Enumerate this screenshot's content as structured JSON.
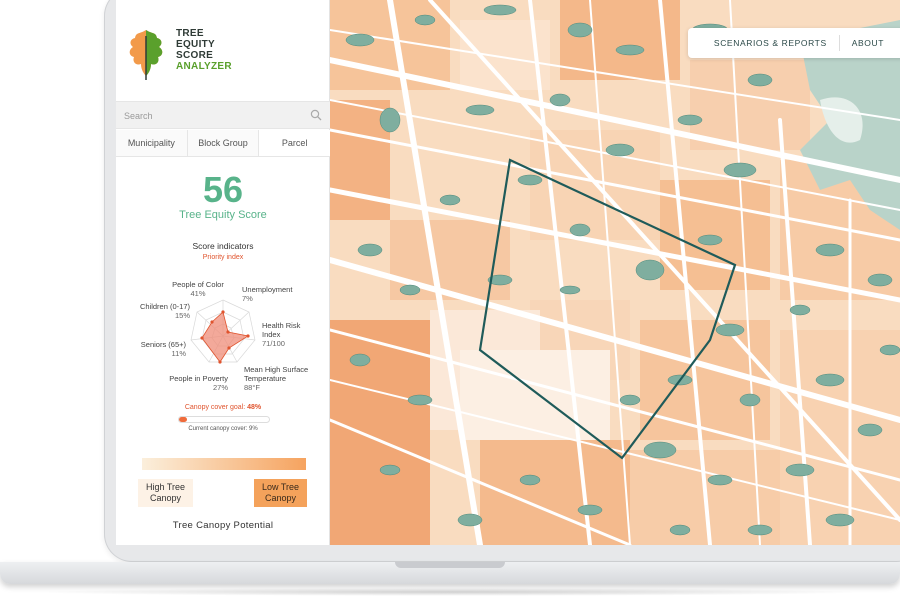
{
  "app": {
    "logo_lines": [
      "TREE",
      "EQUITY",
      "SCORE"
    ],
    "logo_accent": "ANALYZER"
  },
  "search": {
    "placeholder": "Search"
  },
  "tabs": [
    {
      "label": "Municipality"
    },
    {
      "label": "Block Group"
    },
    {
      "label": "Parcel"
    }
  ],
  "score": {
    "value": "56",
    "label": "Tree Equity Score"
  },
  "indicators": {
    "title": "Score indicators",
    "subtitle": "Priority index",
    "items": [
      {
        "name": "People of Color",
        "value": "41%"
      },
      {
        "name": "Unemployment",
        "value": "7%"
      },
      {
        "name": "Health Risk Index",
        "value": "71/100"
      },
      {
        "name": "Mean High Surface Temperature",
        "value": "88°F"
      },
      {
        "name": "People in Poverty",
        "value": "27%"
      },
      {
        "name": "Seniors (65+)",
        "value": "11%"
      },
      {
        "name": "Children (0-17)",
        "value": "15%"
      }
    ]
  },
  "canopy": {
    "goal_label": "Canopy cover goal:",
    "goal_value": "48%",
    "current_label": "Current canopy cover: 9%",
    "current_fraction": 0.09,
    "legend_high": "High Tree Canopy",
    "legend_low": "Low Tree Canopy",
    "title": "Tree Canopy Potential"
  },
  "nav": {
    "scenarios": "SCENARIOS & REPORTS",
    "about": "ABOUT"
  },
  "colors": {
    "score_green": "#58b38a",
    "accent_red": "#e0542e",
    "map_tree": "#7fae9f",
    "map_polygon": "#1f5b5a",
    "map_land": "#f7c9a2"
  }
}
